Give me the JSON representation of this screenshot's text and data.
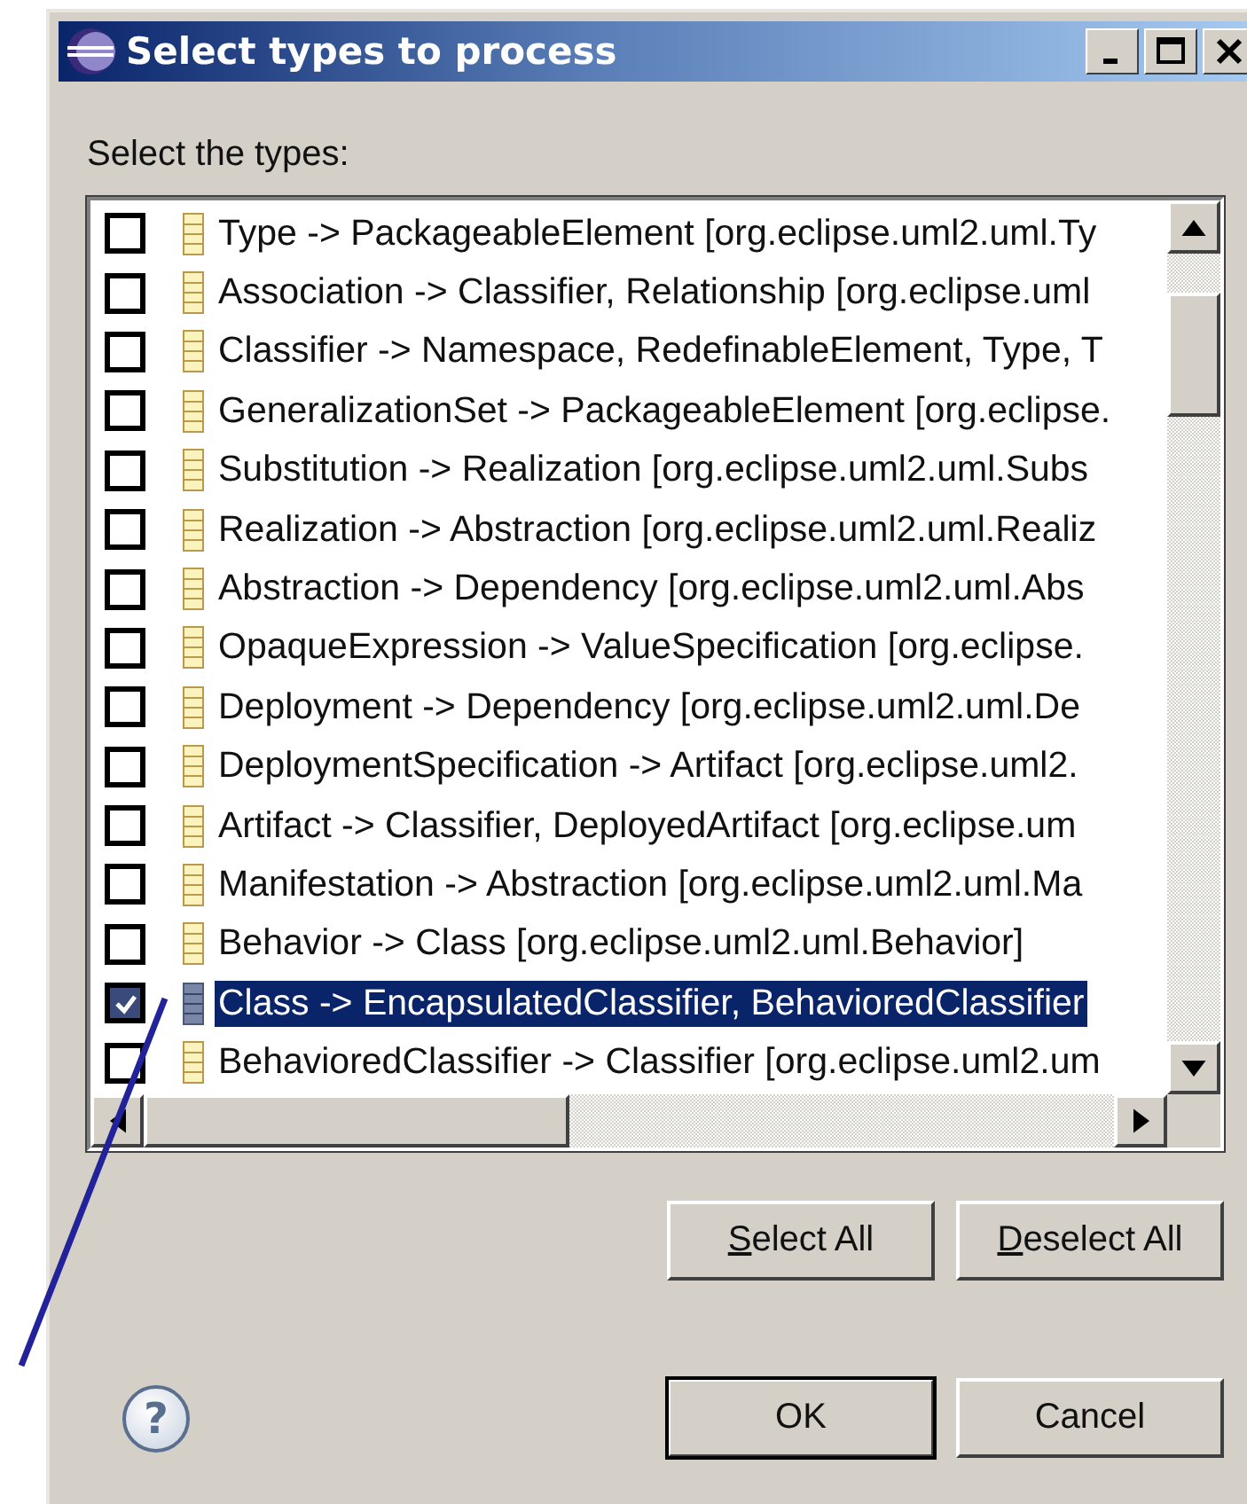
{
  "window": {
    "title": "Select types to process"
  },
  "prompt": "Select the types:",
  "types": [
    {
      "label": "Type -> PackageableElement [org.eclipse.uml2.uml.Ty",
      "checked": false,
      "selected": false
    },
    {
      "label": "Association -> Classifier, Relationship [org.eclipse.uml",
      "checked": false,
      "selected": false
    },
    {
      "label": "Classifier -> Namespace, RedefinableElement, Type, T",
      "checked": false,
      "selected": false
    },
    {
      "label": "GeneralizationSet -> PackageableElement [org.eclipse.",
      "checked": false,
      "selected": false
    },
    {
      "label": "Substitution -> Realization [org.eclipse.uml2.uml.Subs",
      "checked": false,
      "selected": false
    },
    {
      "label": "Realization -> Abstraction [org.eclipse.uml2.uml.Realiz",
      "checked": false,
      "selected": false
    },
    {
      "label": "Abstraction -> Dependency [org.eclipse.uml2.uml.Abs",
      "checked": false,
      "selected": false
    },
    {
      "label": "OpaqueExpression -> ValueSpecification [org.eclipse.",
      "checked": false,
      "selected": false
    },
    {
      "label": "Deployment -> Dependency [org.eclipse.uml2.uml.De",
      "checked": false,
      "selected": false
    },
    {
      "label": "DeploymentSpecification -> Artifact [org.eclipse.uml2.",
      "checked": false,
      "selected": false
    },
    {
      "label": "Artifact -> Classifier, DeployedArtifact [org.eclipse.um",
      "checked": false,
      "selected": false
    },
    {
      "label": "Manifestation -> Abstraction [org.eclipse.uml2.uml.Ma",
      "checked": false,
      "selected": false
    },
    {
      "label": "Behavior -> Class [org.eclipse.uml2.uml.Behavior]",
      "checked": false,
      "selected": false
    },
    {
      "label": "Class -> EncapsulatedClassifier, BehavioredClassifier",
      "checked": true,
      "selected": true
    },
    {
      "label": "BehavioredClassifier -> Classifier [org.eclipse.uml2.um",
      "checked": false,
      "selected": false
    }
  ],
  "list_buttons": [
    {
      "label": "Select All",
      "mnemonic_underlined": true,
      "default": false
    },
    {
      "label": "Deselect All",
      "mnemonic_underlined": true,
      "default": false
    }
  ],
  "help_icon": "?",
  "dialog_buttons": [
    {
      "label": "OK",
      "mnemonic_underlined": false,
      "default": true
    },
    {
      "label": "Cancel",
      "mnemonic_underlined": false,
      "default": false
    }
  ]
}
